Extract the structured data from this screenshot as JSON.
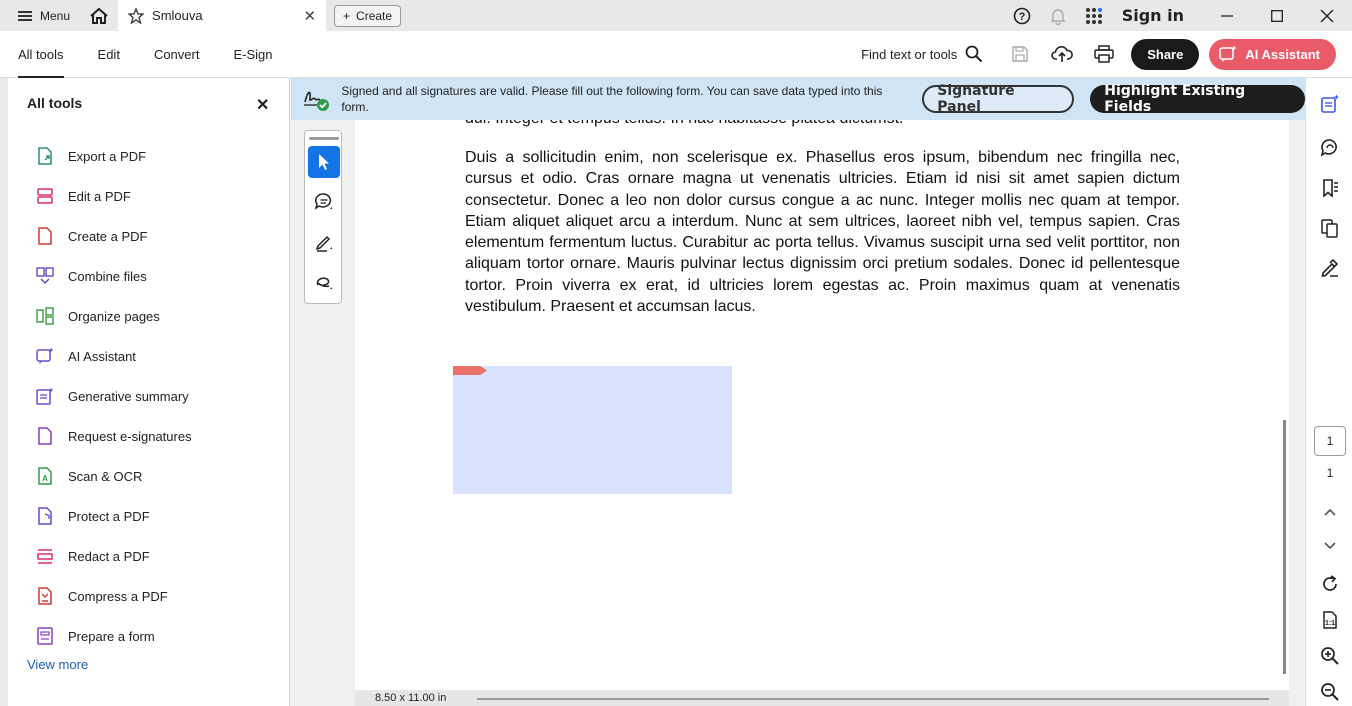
{
  "titlebar": {
    "menu_label": "Menu",
    "tab_title": "Smlouva",
    "create_label": "Create",
    "signin_label": "Sign in"
  },
  "toolbar": {
    "nav": [
      "All tools",
      "Edit",
      "Convert",
      "E-Sign"
    ],
    "active_nav": "All tools",
    "find_label": "Find text or tools",
    "share_label": "Share",
    "ai_label": "AI Assistant"
  },
  "left_panel": {
    "title": "All tools",
    "tools": [
      {
        "label": "Export a PDF",
        "icon": "export-pdf-icon",
        "color": "#2e8f6a"
      },
      {
        "label": "Edit a PDF",
        "icon": "edit-pdf-icon",
        "color": "#d9336b"
      },
      {
        "label": "Create a PDF",
        "icon": "create-pdf-icon",
        "color": "#d43a3a"
      },
      {
        "label": "Combine files",
        "icon": "combine-files-icon",
        "color": "#5a4fcf"
      },
      {
        "label": "Organize pages",
        "icon": "organize-pages-icon",
        "color": "#3a9a3a"
      },
      {
        "label": "AI Assistant",
        "icon": "ai-assistant-icon",
        "color": "#6a4fd0"
      },
      {
        "label": "Generative summary",
        "icon": "generative-summary-icon",
        "color": "#6a4fd0"
      },
      {
        "label": "Request e-signatures",
        "icon": "request-esignatures-icon",
        "color": "#8a3fc0"
      },
      {
        "label": "Scan & OCR",
        "icon": "scan-ocr-icon",
        "color": "#2f9a4a"
      },
      {
        "label": "Protect a PDF",
        "icon": "protect-pdf-icon",
        "color": "#5a4fcf"
      },
      {
        "label": "Redact a PDF",
        "icon": "redact-pdf-icon",
        "color": "#d9336b"
      },
      {
        "label": "Compress a PDF",
        "icon": "compress-pdf-icon",
        "color": "#d43a3a"
      },
      {
        "label": "Prepare a form",
        "icon": "prepare-form-icon",
        "color": "#8a3fc0"
      }
    ],
    "view_more": "View more"
  },
  "notification": {
    "text": "Signed and all signatures are valid.  Please fill out the following form. You can save data typed into this form.",
    "signature_panel_label": "Signature Panel",
    "highlight_label": "Highlight Existing Fields",
    "bg_color": "#cfe4f5"
  },
  "document": {
    "cut_line": "dui. Integer et tempus tellus. In hac habitasse platea dictumst.",
    "paragraph": "Duis a sollicitudin enim, non scelerisque ex. Phasellus eros ipsum, bibendum nec fringilla nec, cursus et odio. Cras ornare magna ut venenatis ultricies. Etiam id nisi sit amet sapien dictum consectetur. Donec a leo non dolor cursus congue a ac nunc. Integer mollis nec quam at tempor. Etiam aliquet aliquet arcu a interdum. Nunc at sem ultrices, laoreet nibh vel, tempus sapien. Cras elementum fermentum luctus. Curabitur ac porta tellus. Vivamus suscipit urna sed velit porttitor, non aliquam tortor ornare. Mauris pulvinar lectus dignissim orci pretium sodales. Donec id pellentesque tortor. Proin viverra ex erat, id ultricies lorem egestas ac. Proin maximus quam at venenatis vestibulum. Praesent et accumsan lacus.",
    "page_size": "8.50 x 11.00 in",
    "signature_field_color": "#d8e2fc"
  },
  "pagination": {
    "current": "1",
    "total": "1"
  },
  "colors": {
    "accent": "#1473e6",
    "ai_button": "#ea5b6a",
    "link": "#1b5fb8"
  }
}
